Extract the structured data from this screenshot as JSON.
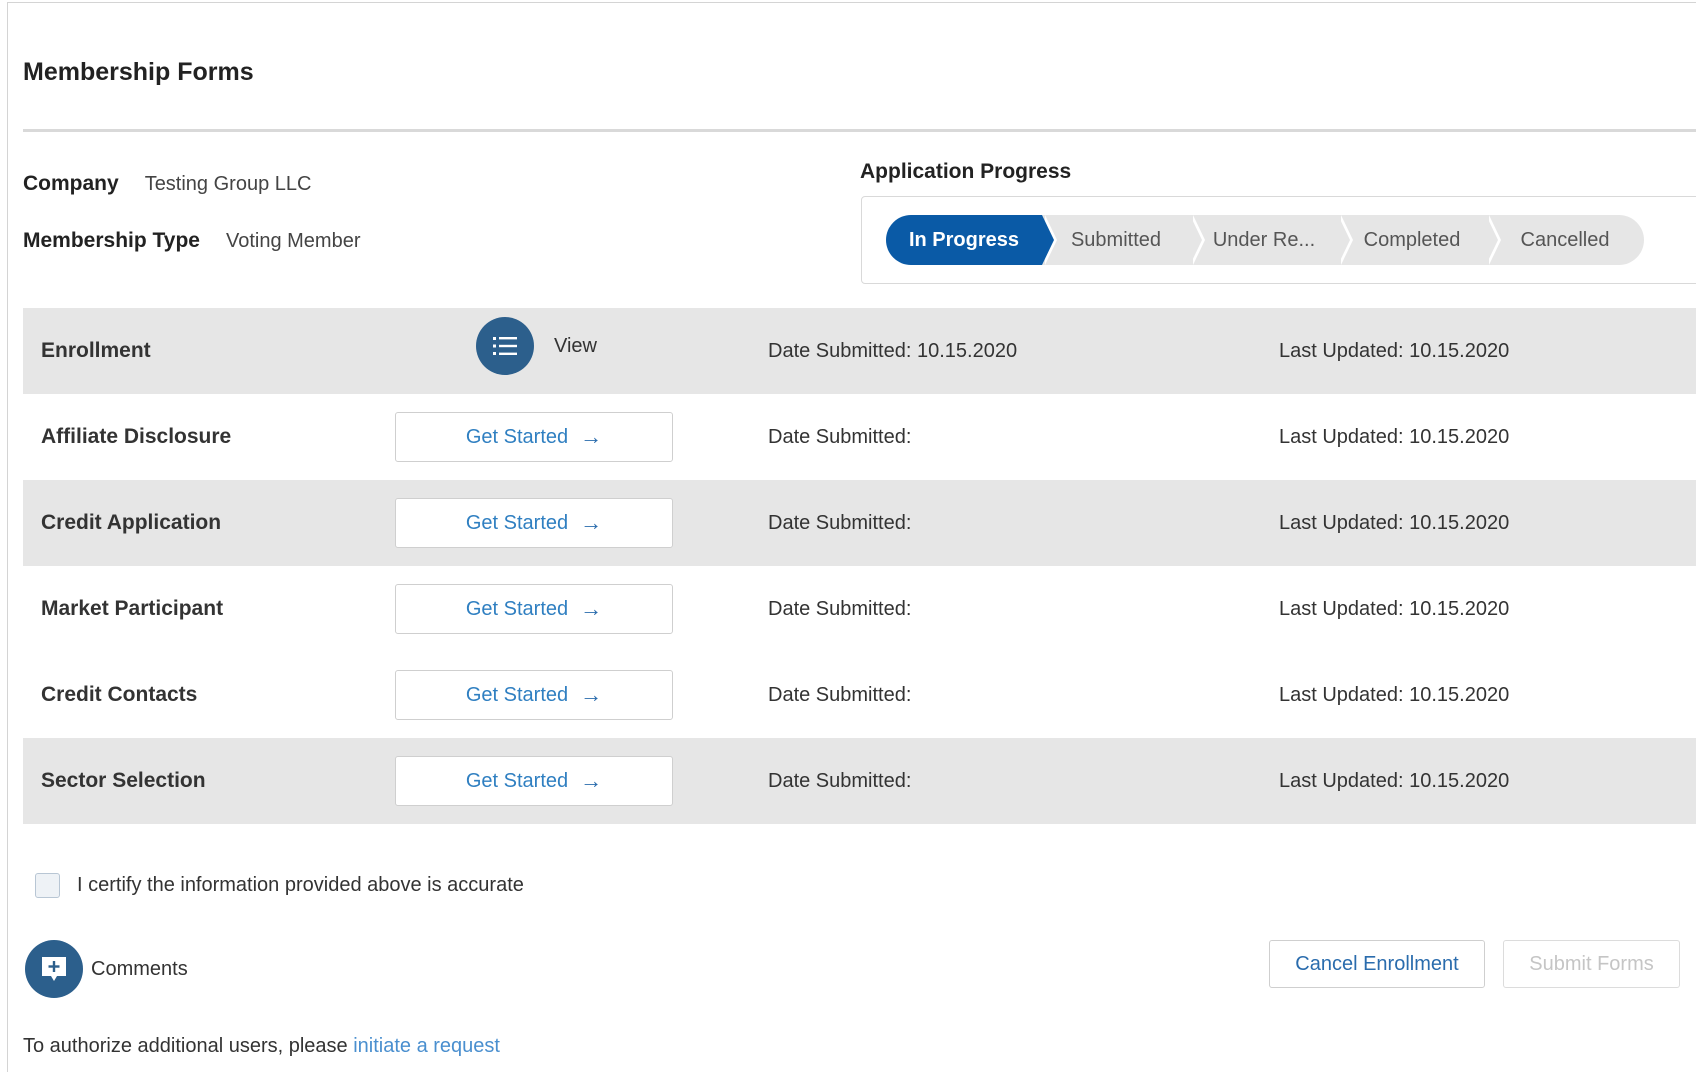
{
  "page": {
    "title": "Membership Forms"
  },
  "info": {
    "company_label": "Company",
    "company_value": "Testing Group LLC",
    "membership_type_label": "Membership Type",
    "membership_type_value": "Voting Member"
  },
  "progress": {
    "title": "Application Progress",
    "steps": [
      {
        "label": "In Progress",
        "active": true
      },
      {
        "label": "Submitted",
        "active": false
      },
      {
        "label": "Under Re...",
        "active": false
      },
      {
        "label": "Completed",
        "active": false
      },
      {
        "label": "Cancelled",
        "active": false
      }
    ],
    "active_color": "#0a5aa6"
  },
  "forms": [
    {
      "name": "Enrollment",
      "action": "View",
      "action_icon": "list-icon",
      "date_submitted": "Date Submitted: 10.15.2020",
      "last_updated": "Last Updated: 10.15.2020"
    },
    {
      "name": "Affiliate Disclosure",
      "action": "Get Started",
      "action_icon": "arrow-right-icon",
      "date_submitted": "Date Submitted:",
      "last_updated": "Last Updated: 10.15.2020"
    },
    {
      "name": "Credit Application",
      "action": "Get Started",
      "action_icon": "arrow-right-icon",
      "date_submitted": "Date Submitted:",
      "last_updated": "Last Updated: 10.15.2020"
    },
    {
      "name": "Market Participant",
      "action": "Get Started",
      "action_icon": "arrow-right-icon",
      "date_submitted": "Date Submitted:",
      "last_updated": "Last Updated: 10.15.2020"
    },
    {
      "name": "Credit Contacts",
      "action": "Get Started",
      "action_icon": "arrow-right-icon",
      "date_submitted": "Date Submitted:",
      "last_updated": "Last Updated: 10.15.2020"
    },
    {
      "name": "Sector Selection",
      "action": "Get Started",
      "action_icon": "arrow-right-icon",
      "date_submitted": "Date Submitted:",
      "last_updated": "Last Updated: 10.15.2020"
    }
  ],
  "certify": {
    "label": "I certify the information provided above is accurate",
    "checked": false
  },
  "comments": {
    "label": "Comments",
    "icon": "add-comment-icon"
  },
  "buttons": {
    "cancel_label": "Cancel Enrollment",
    "submit_label": "Submit Forms"
  },
  "footer": {
    "text": "To authorize additional users, please ",
    "link_label": "initiate a request"
  }
}
